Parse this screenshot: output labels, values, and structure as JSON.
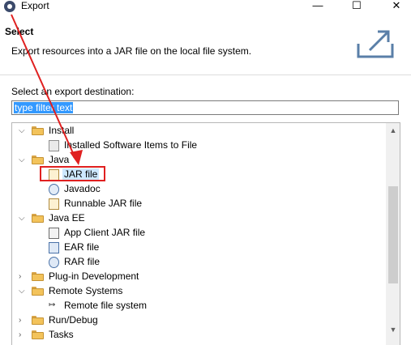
{
  "window": {
    "title": "Export",
    "minimize": "—",
    "maximize": "☐",
    "close": "✕"
  },
  "header": {
    "title": "Select",
    "description": "Export resources into a JAR file on the local file system."
  },
  "destination_label": "Select an export destination:",
  "filter": {
    "value": "type filter text"
  },
  "tree": {
    "install": {
      "label": "Install",
      "items": [
        "Installed Software Items to File"
      ]
    },
    "java": {
      "label": "Java",
      "items": [
        "JAR file",
        "Javadoc",
        "Runnable JAR file"
      ]
    },
    "java_ee": {
      "label": "Java EE",
      "items": [
        "App Client JAR file",
        "EAR file",
        "RAR file"
      ]
    },
    "plugin": {
      "label": "Plug-in Development"
    },
    "remote": {
      "label": "Remote Systems",
      "items": [
        "Remote file system"
      ]
    },
    "rundebug": {
      "label": "Run/Debug"
    },
    "tasks": {
      "label": "Tasks"
    }
  },
  "colors": {
    "annotation": "#e02020",
    "selection": "#cde8ff",
    "filter_highlight": "#3399ff"
  },
  "icons": [
    "eclipse-icon",
    "export-icon",
    "folder-icon",
    "jar-icon",
    "javadoc-icon"
  ]
}
